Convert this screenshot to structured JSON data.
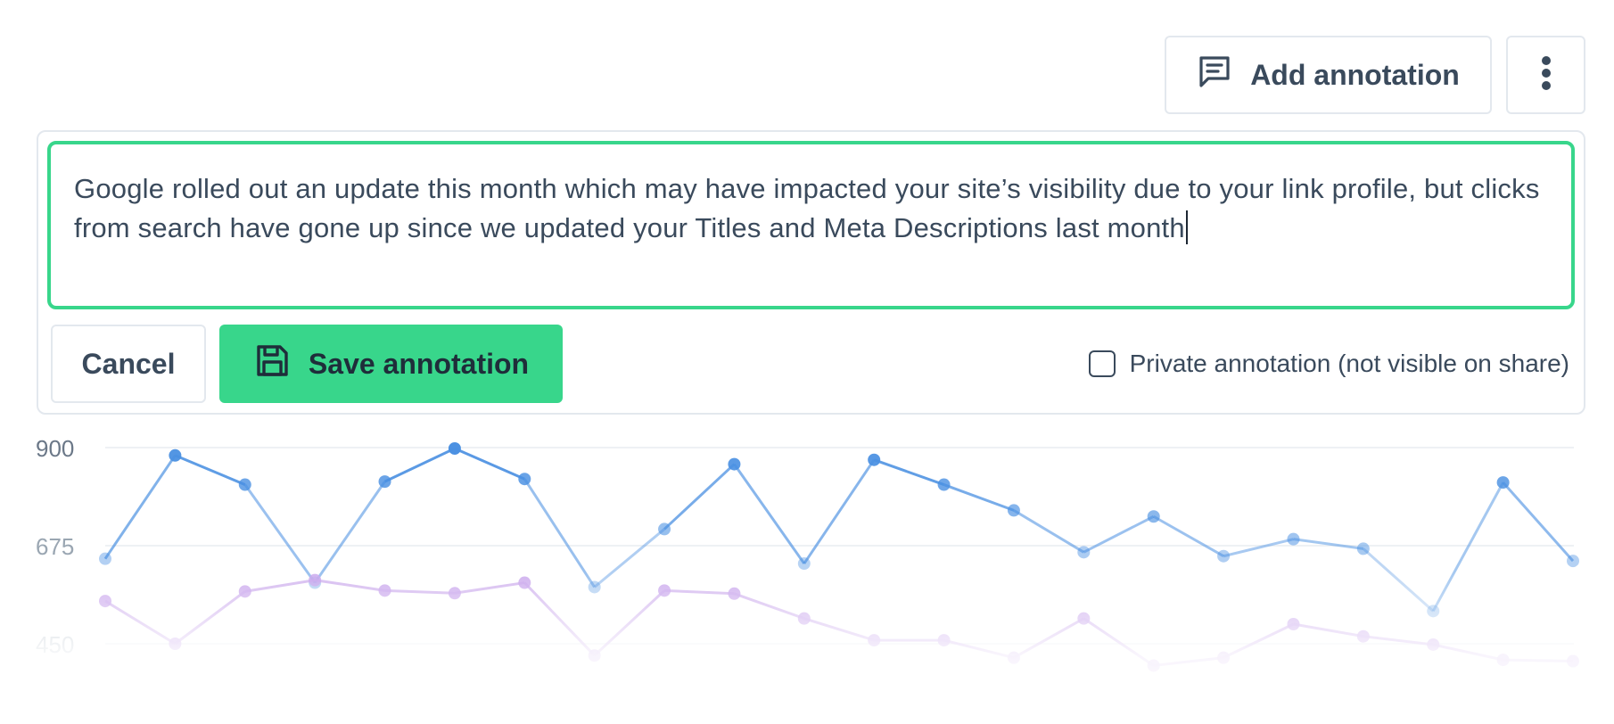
{
  "toolbar": {
    "add_annotation_label": "Add annotation",
    "add_annotation_icon": "comment-icon",
    "more_icon": "more-vertical-icon"
  },
  "annotation": {
    "text": "Google rolled out an update this month which may have impacted your site’s visibility due to your link profile, but clicks from search have gone up since we updated your Titles and Meta Descriptions last month",
    "cancel_label": "Cancel",
    "save_label": "Save annotation",
    "save_icon": "save-icon",
    "private_label": "Private annotation (not visible on share)",
    "private_checked": false
  },
  "colors": {
    "accent": "#38d68b",
    "series_blue": "#4a90e2",
    "series_purple": "#c9a6ec",
    "text": "#3a4a5c"
  },
  "chart_data": {
    "type": "line",
    "y_ticks": [
      "900",
      "675",
      "450"
    ],
    "ylim": [
      370,
      960
    ],
    "grid": true,
    "series": [
      {
        "color": "#4a90e2",
        "values": [
          645,
          882,
          815,
          590,
          822,
          898,
          828,
          580,
          713,
          862,
          634,
          872,
          815,
          756,
          660,
          742,
          651,
          690,
          668,
          525,
          820,
          640
        ]
      },
      {
        "color": "#c9a6ec",
        "values": [
          548,
          450,
          570,
          596,
          572,
          566,
          590,
          423,
          572,
          565,
          508,
          458,
          458,
          418,
          508,
          400,
          418,
          495,
          467,
          448,
          413,
          410
        ]
      }
    ]
  }
}
